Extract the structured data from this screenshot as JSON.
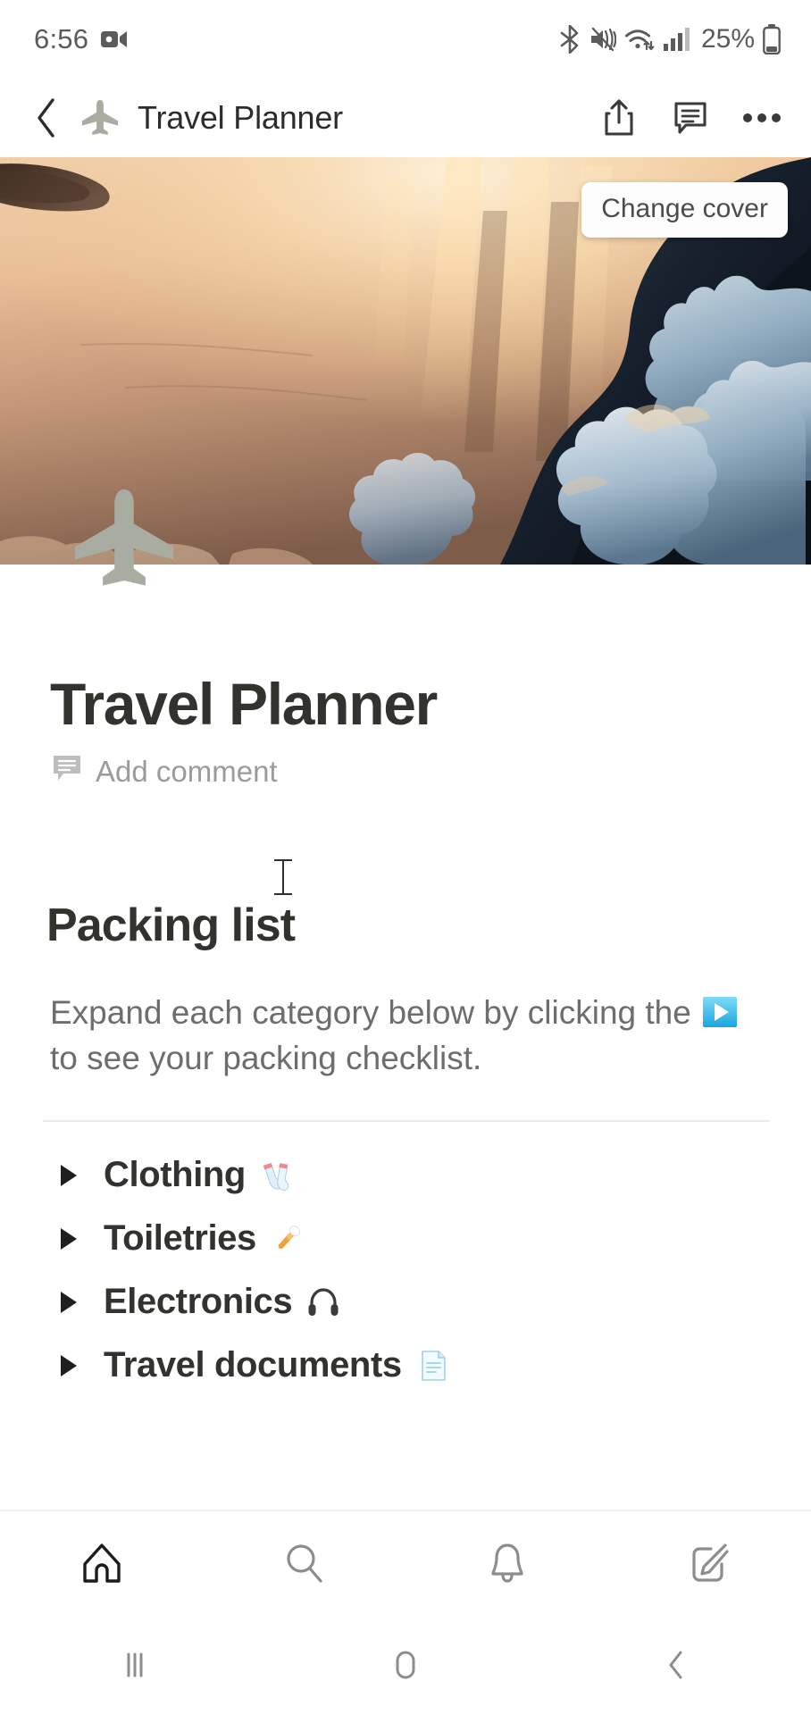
{
  "status_bar": {
    "time": "6:56",
    "battery_percent": "25%",
    "icons": [
      "video-recording-icon",
      "bluetooth-icon",
      "vibrate-mute-icon",
      "wifi-icon",
      "cellular-signal-icon",
      "battery-icon"
    ]
  },
  "app_bar": {
    "back_label": "Back",
    "page_emoji": "airplane",
    "title": "Travel Planner",
    "actions": [
      "share-icon",
      "comment-icon",
      "more-options-icon"
    ]
  },
  "cover": {
    "change_cover_label": "Change cover",
    "description": "Sunset above the clouds seen from an airplane window",
    "colors": {
      "sky_light": "#f4d2ae",
      "sky_warm": "#e8b98f",
      "sky_deep": "#8d6a55",
      "cloud_blue": "#7f9bb4",
      "cloud_dark": "#10161f",
      "sun_glow": "#f7e0bd"
    }
  },
  "page": {
    "icon": "airplane",
    "title": "Travel Planner",
    "add_comment_label": "Add comment",
    "heading": "Packing list",
    "description_part1": "Expand each category below by clicking the ",
    "description_emoji": "play-button",
    "description_part2": " to see your packing checklist."
  },
  "toggles": [
    {
      "label": "Clothing",
      "emoji": "socks",
      "expanded": false
    },
    {
      "label": "Toiletries",
      "emoji": "toothbrush",
      "expanded": false
    },
    {
      "label": "Electronics",
      "emoji": "headphone",
      "expanded": false
    },
    {
      "label": "Travel documents",
      "emoji": "page",
      "expanded": false
    }
  ],
  "tab_bar": {
    "items": [
      {
        "name": "home",
        "active": true
      },
      {
        "name": "search",
        "active": false
      },
      {
        "name": "notifications",
        "active": false
      },
      {
        "name": "new-page",
        "active": false
      }
    ]
  },
  "system_nav": {
    "items": [
      "recents",
      "home",
      "back"
    ]
  },
  "theme": {
    "text_primary": "#32322e",
    "text_secondary": "#6d6d6d",
    "text_muted": "#9b9b9b",
    "divider": "#eceaea",
    "background": "#ffffff"
  }
}
